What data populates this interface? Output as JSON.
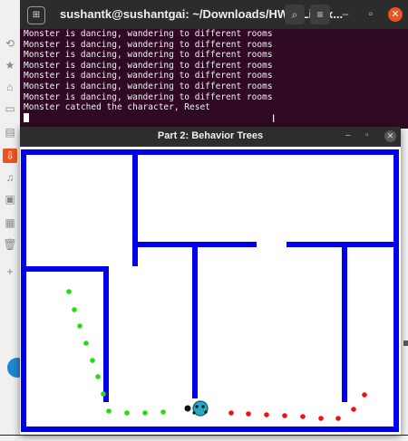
{
  "terminal": {
    "title": "sushantk@sushantgai: ~/Downloads/HW4_Linux...",
    "menu_icon": "plus-tab-icon",
    "search_icon": "search-icon",
    "hamburger_icon": "hamburger-icon",
    "minimize_icon": "minimize-icon",
    "maximize_icon": "maximize-icon",
    "close_icon": "close-icon",
    "lines": [
      "Monster is dancing, wandering to different rooms",
      "Monster is dancing, wandering to different rooms",
      "Monster is dancing, wandering to different rooms",
      "Monster is dancing, wandering to different rooms",
      "Monster is dancing, wandering to different rooms",
      "Monster is dancing, wandering to different rooms",
      "Monster is dancing, wandering to different rooms",
      "Monster catched the character, Reset"
    ]
  },
  "bt_window": {
    "title": "Part 2: Behavior Trees",
    "minimize_icon": "minimize-icon",
    "maximize_icon": "maximize-icon",
    "close_icon": "close-icon"
  },
  "colors": {
    "wall": "#0000ee",
    "trail_green": "#22dd11",
    "trail_red": "#ee1111",
    "terminal_bg": "#300a24",
    "accent": "#e95420"
  }
}
